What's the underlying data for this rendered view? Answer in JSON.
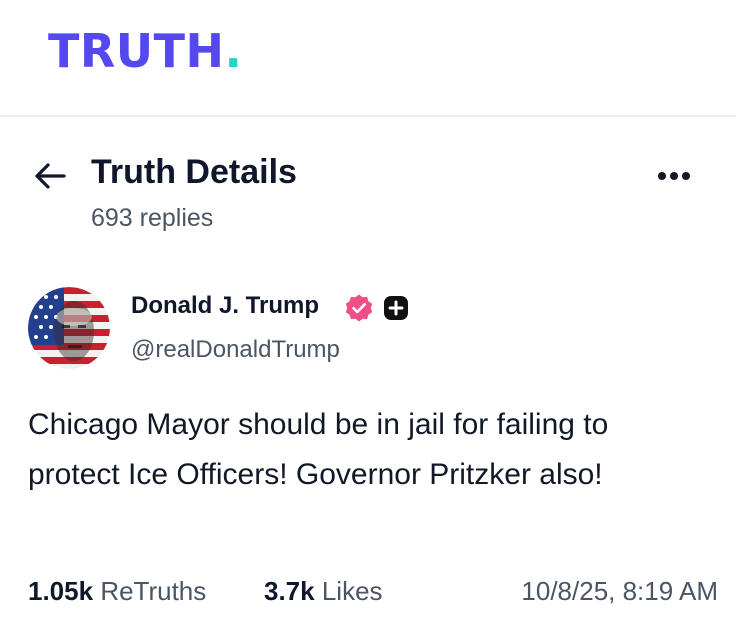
{
  "brand": {
    "logo_text": "TRUTH",
    "logo_dot": ".",
    "logo_color": "#5448ee",
    "dot_color": "#1fd5c3"
  },
  "header": {
    "back_icon": "arrow-left-icon",
    "title": "Truth Details",
    "more_icon": "more-horizontal-icon",
    "reply_count": "693 replies"
  },
  "post": {
    "author": {
      "name": "Donald J. Trump",
      "handle": "@realDonaldTrump",
      "verified_icon": "verified-badge-icon",
      "verified_color": "#ee4f87",
      "plus_icon": "plus-square-icon"
    },
    "text": "Chicago Mayor should be in jail for failing to protect Ice Officers! Governor Pritzker also!",
    "stats": {
      "retruths_count": "1.05k",
      "retruths_label": "ReTruths",
      "likes_count": "3.7k",
      "likes_label": "Likes",
      "timestamp": "10/8/25, 8:19 AM"
    }
  }
}
